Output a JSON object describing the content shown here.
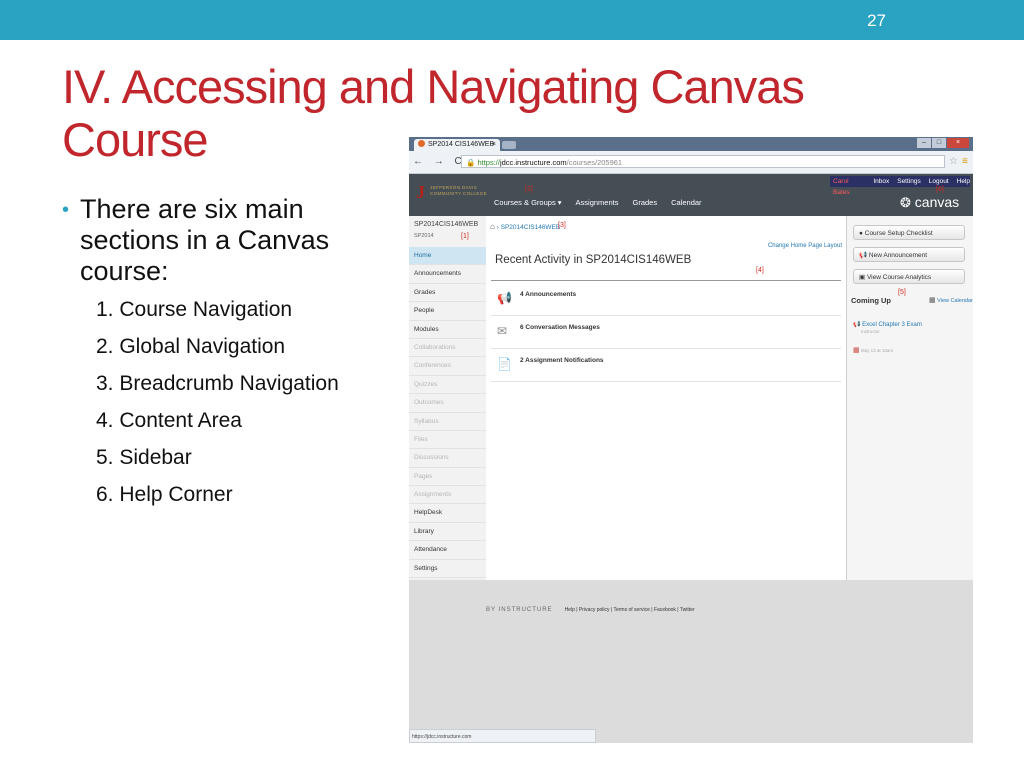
{
  "slide": {
    "number": "27",
    "title": "IV. Accessing and Navigating Canvas Course",
    "bullet": "There are six main sections in a Canvas course:",
    "sections": [
      "1. Course Navigation",
      "2. Global Navigation",
      "3. Breadcrumb Navigation",
      "4. Content Area",
      "5. Sidebar",
      "6. Help Corner"
    ]
  },
  "browser": {
    "tab_title": "SP2014 CIS146WEB",
    "tab_close": "×",
    "nav_buttons": "← → C ⌂",
    "url_protocol": "https://",
    "url_host": "jdcc.instructure.com",
    "url_path": "/courses/205961",
    "win_min": "–",
    "win_max": "□",
    "win_close": "×"
  },
  "canvas": {
    "logo_mark": "J",
    "logo_line1": "JEFFERSON DAVIS",
    "logo_line2": "COMMUNITY COLLEGE",
    "global_nav": [
      "Courses & Groups ▾",
      "Assignments",
      "Grades",
      "Calendar"
    ],
    "user_nav": [
      "Carol Bates",
      "Inbox",
      "Settings",
      "Logout",
      "Help"
    ],
    "brand": "canvas",
    "markers": {
      "m1": "[1]",
      "m2": "[2]",
      "m3": "[3]",
      "m4": "[4]",
      "m5": "[5]",
      "m6": "[6]"
    },
    "course_name": "SP2014CIS146WEB",
    "term": "SP2014",
    "course_nav": [
      {
        "label": "Home",
        "state": "active"
      },
      {
        "label": "Announcements",
        "state": "normal"
      },
      {
        "label": "Grades",
        "state": "normal"
      },
      {
        "label": "People",
        "state": "normal"
      },
      {
        "label": "Modules",
        "state": "normal"
      },
      {
        "label": "Collaborations",
        "state": "dim"
      },
      {
        "label": "Conferences",
        "state": "dim"
      },
      {
        "label": "Quizzes",
        "state": "dim"
      },
      {
        "label": "Outcomes",
        "state": "dim"
      },
      {
        "label": "Syllabus",
        "state": "dim"
      },
      {
        "label": "Files",
        "state": "dim"
      },
      {
        "label": "Discussions",
        "state": "dim"
      },
      {
        "label": "Pages",
        "state": "dim"
      },
      {
        "label": "Assignments",
        "state": "dim"
      },
      {
        "label": "HelpDesk",
        "state": "normal"
      },
      {
        "label": "Library",
        "state": "normal"
      },
      {
        "label": "Attendance",
        "state": "normal"
      },
      {
        "label": "Settings",
        "state": "normal"
      }
    ],
    "breadcrumb": "SP2014CIS146WEB",
    "change_layout": "Change Home Page Layout",
    "recent_title": "Recent Activity in SP2014CIS146WEB",
    "activities": [
      {
        "icon": "megaphone-icon",
        "glyph": "📢",
        "label": "4 Announcements"
      },
      {
        "icon": "envelope-icon",
        "glyph": "✉",
        "label": "6 Conversation Messages"
      },
      {
        "icon": "assignment-icon",
        "glyph": "📄",
        "label": "2 Assignment Notifications"
      }
    ],
    "sidebar_buttons": [
      "Course Setup Checklist",
      "New Announcement",
      "View Course Analytics"
    ],
    "coming_up": "Coming Up",
    "view_calendar": "View Calendar",
    "upcoming_item": "Excel Chapter 3 Exam",
    "upcoming_sub": "Instructor",
    "upcoming_date": "May 13 at 10am",
    "footer_by": "BY INSTRUCTURE",
    "footer_links": "Help | Privacy policy | Terms of service | Facebook | Twitter",
    "status_url": "https://jdcc.instructure.com"
  },
  "colors": {
    "accent": "#2aa3c2",
    "title": "#c0262c",
    "canvas_header": "#454d55",
    "link": "#2478b5"
  }
}
